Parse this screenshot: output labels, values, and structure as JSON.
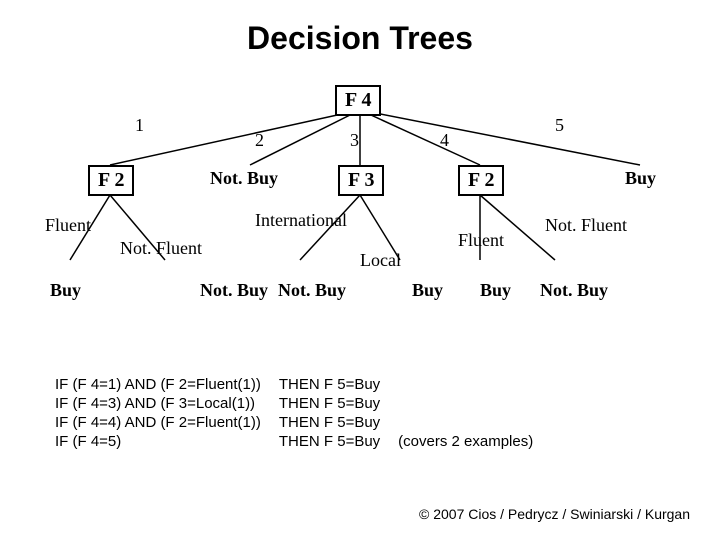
{
  "title": "Decision Trees",
  "tree": {
    "root": "F 4",
    "branches": [
      "1",
      "2",
      "3",
      "4",
      "5"
    ],
    "level2": {
      "n1": "F 2",
      "n2_leaf": "Not. Buy",
      "n3": "F 3",
      "n4": "F 2",
      "n5_leaf": "Buy"
    },
    "f2_left": {
      "b1": "Fluent",
      "b2": "Not. Fluent",
      "l1": "Buy",
      "l2": "Not. Buy"
    },
    "f3": {
      "b1": "International",
      "b2": "Local",
      "l1": "Not. Buy",
      "l2": "Buy"
    },
    "f2_right": {
      "b1": "Fluent",
      "b2": "Not. Fluent",
      "l1": "Buy",
      "l2": "Not. Buy"
    }
  },
  "rules": [
    {
      "if": "IF (F 4=1) AND (F 2=Fluent(1))",
      "then": "THEN F 5=Buy",
      "note": ""
    },
    {
      "if": "IF (F 4=3) AND (F 3=Local(1))",
      "then": "THEN F 5=Buy",
      "note": ""
    },
    {
      "if": "IF (F 4=4) AND (F 2=Fluent(1))",
      "then": "THEN F 5=Buy",
      "note": ""
    },
    {
      "if": "IF (F 4=5)",
      "then": "THEN F 5=Buy",
      "note": "(covers 2 examples)"
    }
  ],
  "footer": "© 2007 Cios / Pedrycz / Swiniarski / Kurgan"
}
